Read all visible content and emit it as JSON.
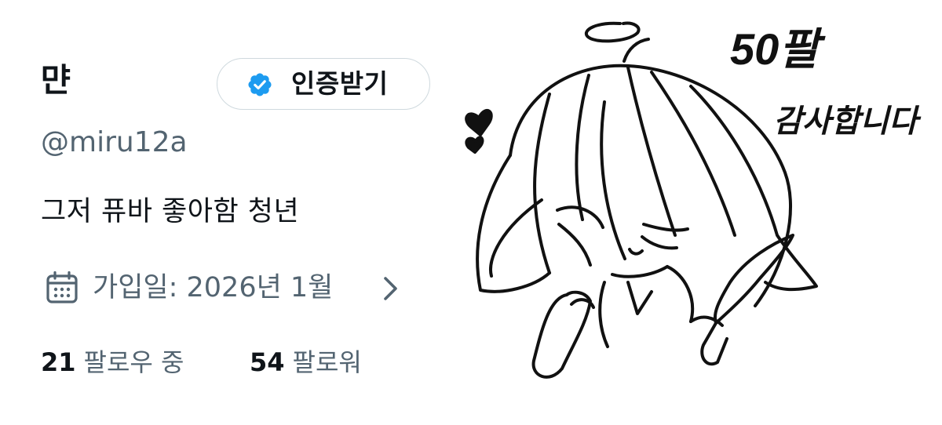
{
  "profile": {
    "display_name": "먄",
    "verify_button_label": "인증받기",
    "handle": "@miru12a",
    "bio": "그저 퓨바 좋아함 청년",
    "joined_text": "가입일: 2026년 1월",
    "following": {
      "count": "21",
      "label": "팔로우 중"
    },
    "followers": {
      "count": "54",
      "label": "팔로워"
    }
  },
  "drawing": {
    "caption_line1": "50팔",
    "caption_line2": "감사합니다"
  },
  "colors": {
    "text_primary": "#0f1419",
    "text_secondary": "#536471",
    "verified_blue": "#1d9bf0",
    "button_border": "#cfd9de"
  },
  "icons": {
    "verified_badge": "verified-badge-icon",
    "calendar": "calendar-icon",
    "chevron": "chevron-right-icon"
  }
}
